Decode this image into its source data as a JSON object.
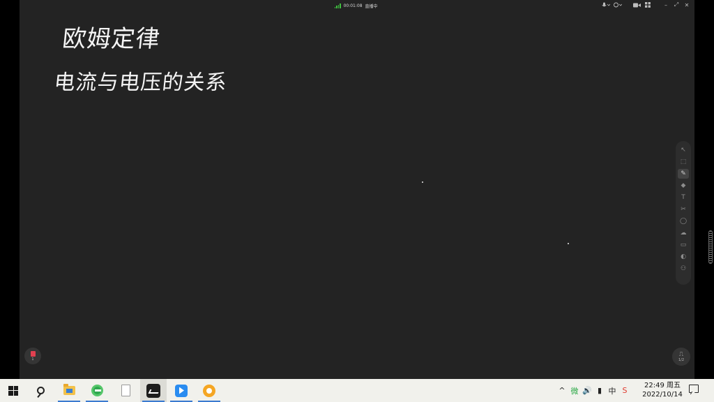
{
  "status_bar": {
    "timer": "00:01:08",
    "state": "直播中"
  },
  "window_controls": {
    "mic_icon": "mic-icon",
    "camera_icon": "camera-icon",
    "grid_icon": "grid-icon",
    "minimize": "–",
    "restore": "⤢",
    "close": "✕"
  },
  "board": {
    "line1": "欧姆定律",
    "line2": "电流与电压的关系"
  },
  "toolbar": {
    "tools": [
      {
        "name": "select-tool",
        "glyph": "↖"
      },
      {
        "name": "marquee-tool",
        "glyph": "⬚"
      },
      {
        "name": "pen-tool",
        "glyph": "✎"
      },
      {
        "name": "eraser-tool",
        "glyph": "◆"
      },
      {
        "name": "text-tool",
        "glyph": "T"
      },
      {
        "name": "scissors-tool",
        "glyph": "✂"
      },
      {
        "name": "shape-tool",
        "glyph": "◯"
      },
      {
        "name": "cloud-tool",
        "glyph": "☁"
      },
      {
        "name": "box-tool",
        "glyph": "▭"
      },
      {
        "name": "video-tool",
        "glyph": "◐"
      },
      {
        "name": "users-tool",
        "glyph": "⚇"
      }
    ],
    "active_index": 2
  },
  "page_left": {
    "count": "1"
  },
  "page_right": {
    "count": "1/2"
  },
  "taskbar": {
    "tray": {
      "chevron": "^",
      "volume": "🔊",
      "ime": "中",
      "wechat": "微",
      "battery": "▮"
    },
    "clock": {
      "time": "22:49 周五",
      "date": "2022/10/14"
    }
  }
}
